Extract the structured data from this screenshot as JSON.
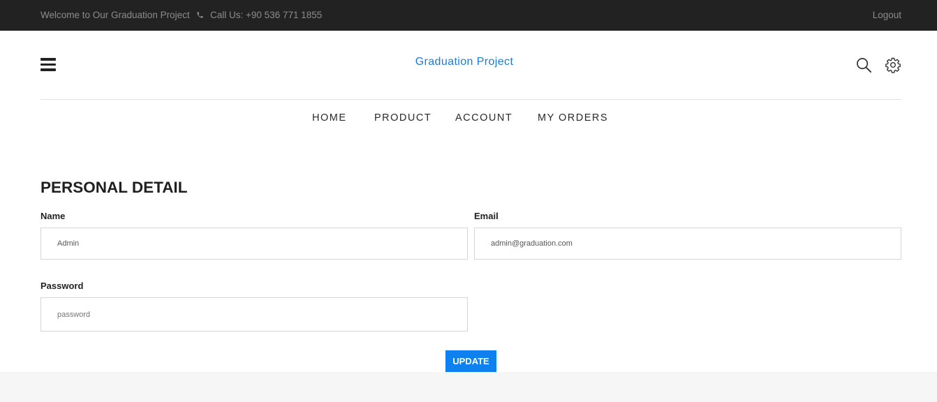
{
  "topbar": {
    "welcome": "Welcome to Our Graduation Project",
    "phone_icon": "phone-icon",
    "phone": "Call Us: +90 536 771 1855",
    "logout": "Logout"
  },
  "header": {
    "menu_icon": "hamburger-menu-icon",
    "brand": "Graduation Project",
    "search_icon": "search-icon",
    "settings_icon": "gear-icon"
  },
  "nav": {
    "items": [
      {
        "label": "HOME"
      },
      {
        "label": "PRODUCT"
      },
      {
        "label": "ACCOUNT"
      },
      {
        "label": "MY ORDERS"
      }
    ]
  },
  "form": {
    "title": "PERSONAL DETAIL",
    "name_label": "Name",
    "name_value": "Admin",
    "email_label": "Email",
    "email_value": "admin@graduation.com",
    "password_label": "Password",
    "password_placeholder": "password",
    "update_label": "UPDATE"
  },
  "colors": {
    "topbar_bg": "#222222",
    "brand": "#1f7ad6",
    "button": "#0e80f0"
  }
}
